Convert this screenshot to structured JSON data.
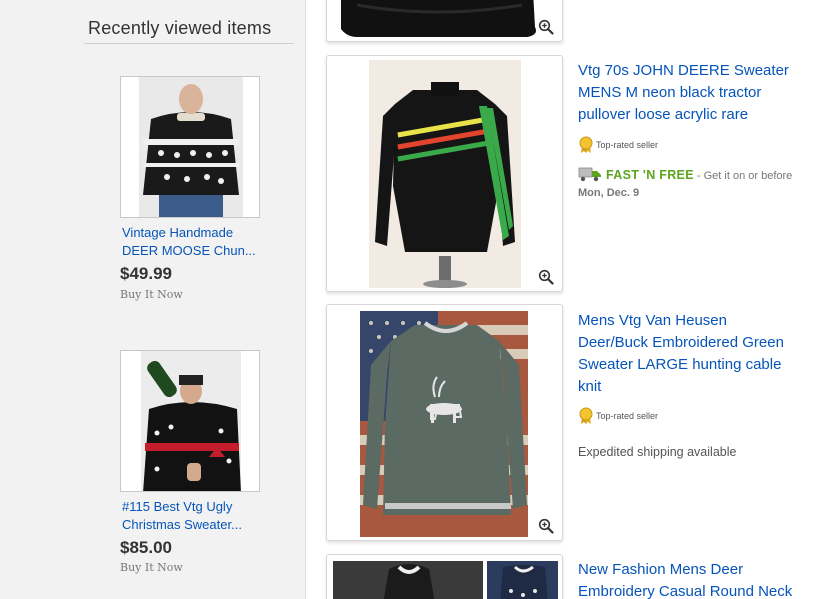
{
  "sidebar": {
    "title": "Recently viewed items",
    "items": [
      {
        "title_line1": "Vintage Handmade",
        "title_line2": "DEER MOOSE Chun...",
        "price": "$49.99",
        "format": "Buy It Now"
      },
      {
        "title_line1": "#115 Best Vtg Ugly",
        "title_line2": "Christmas Sweater...",
        "price": "$85.00",
        "format": "Buy It Now"
      }
    ]
  },
  "results": [
    {
      "title_lines": [
        "Vtg 70s JOHN DEERE Sweater",
        "MENS M neon black tractor",
        "pullover loose acrylic rare"
      ],
      "seller_badge": "Top-rated seller",
      "shipping_tag": "FAST 'N FREE",
      "shipping_text": " - Get it on or before",
      "delivery_date": "Mon, Dec. 9"
    },
    {
      "title_lines": [
        "Mens Vtg Van Heusen",
        "Deer/Buck Embroidered Green",
        "Sweater LARGE hunting cable",
        "knit"
      ],
      "seller_badge": "Top-rated seller",
      "shipping_text": "Expedited shipping available"
    },
    {
      "title_lines": [
        "New Fashion Mens Deer",
        "Embroidery Casual Round Neck"
      ]
    }
  ],
  "icons": {
    "zoom": "zoom-in-icon",
    "badge": "top-rated-seller-icon",
    "truck": "delivery-truck-icon"
  },
  "colors": {
    "link": "#0654ba",
    "fast_n_free": "#5ba51f",
    "sidebar_bg": "#f2f2f2"
  }
}
